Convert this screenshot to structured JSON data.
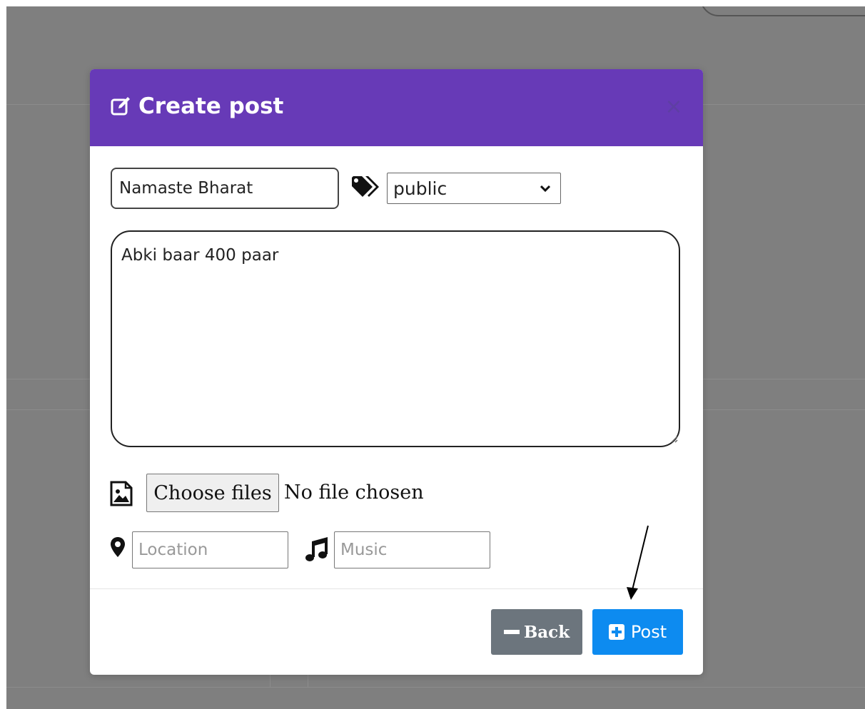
{
  "modal": {
    "title": "Create post",
    "title_icon": "edit-icon",
    "close_label": "×"
  },
  "form": {
    "post_title_value": "Namaste Bharat",
    "privacy": {
      "selected": "public",
      "icon": "tags-icon"
    },
    "body_text": "Abki baar 400 paar",
    "file_input": {
      "button_label": "Choose files",
      "status": "No file chosen",
      "icon": "image-icon"
    },
    "location": {
      "placeholder": "Location",
      "icon": "map-pin-icon"
    },
    "music": {
      "placeholder": "Music",
      "icon": "music-icon"
    }
  },
  "footer": {
    "back_label": "Back",
    "post_label": "Post"
  },
  "colors": {
    "header": "#673ab7",
    "back_button": "#6c757d",
    "post_button": "#0d8bf0",
    "backdrop": "#7f7f7f"
  }
}
